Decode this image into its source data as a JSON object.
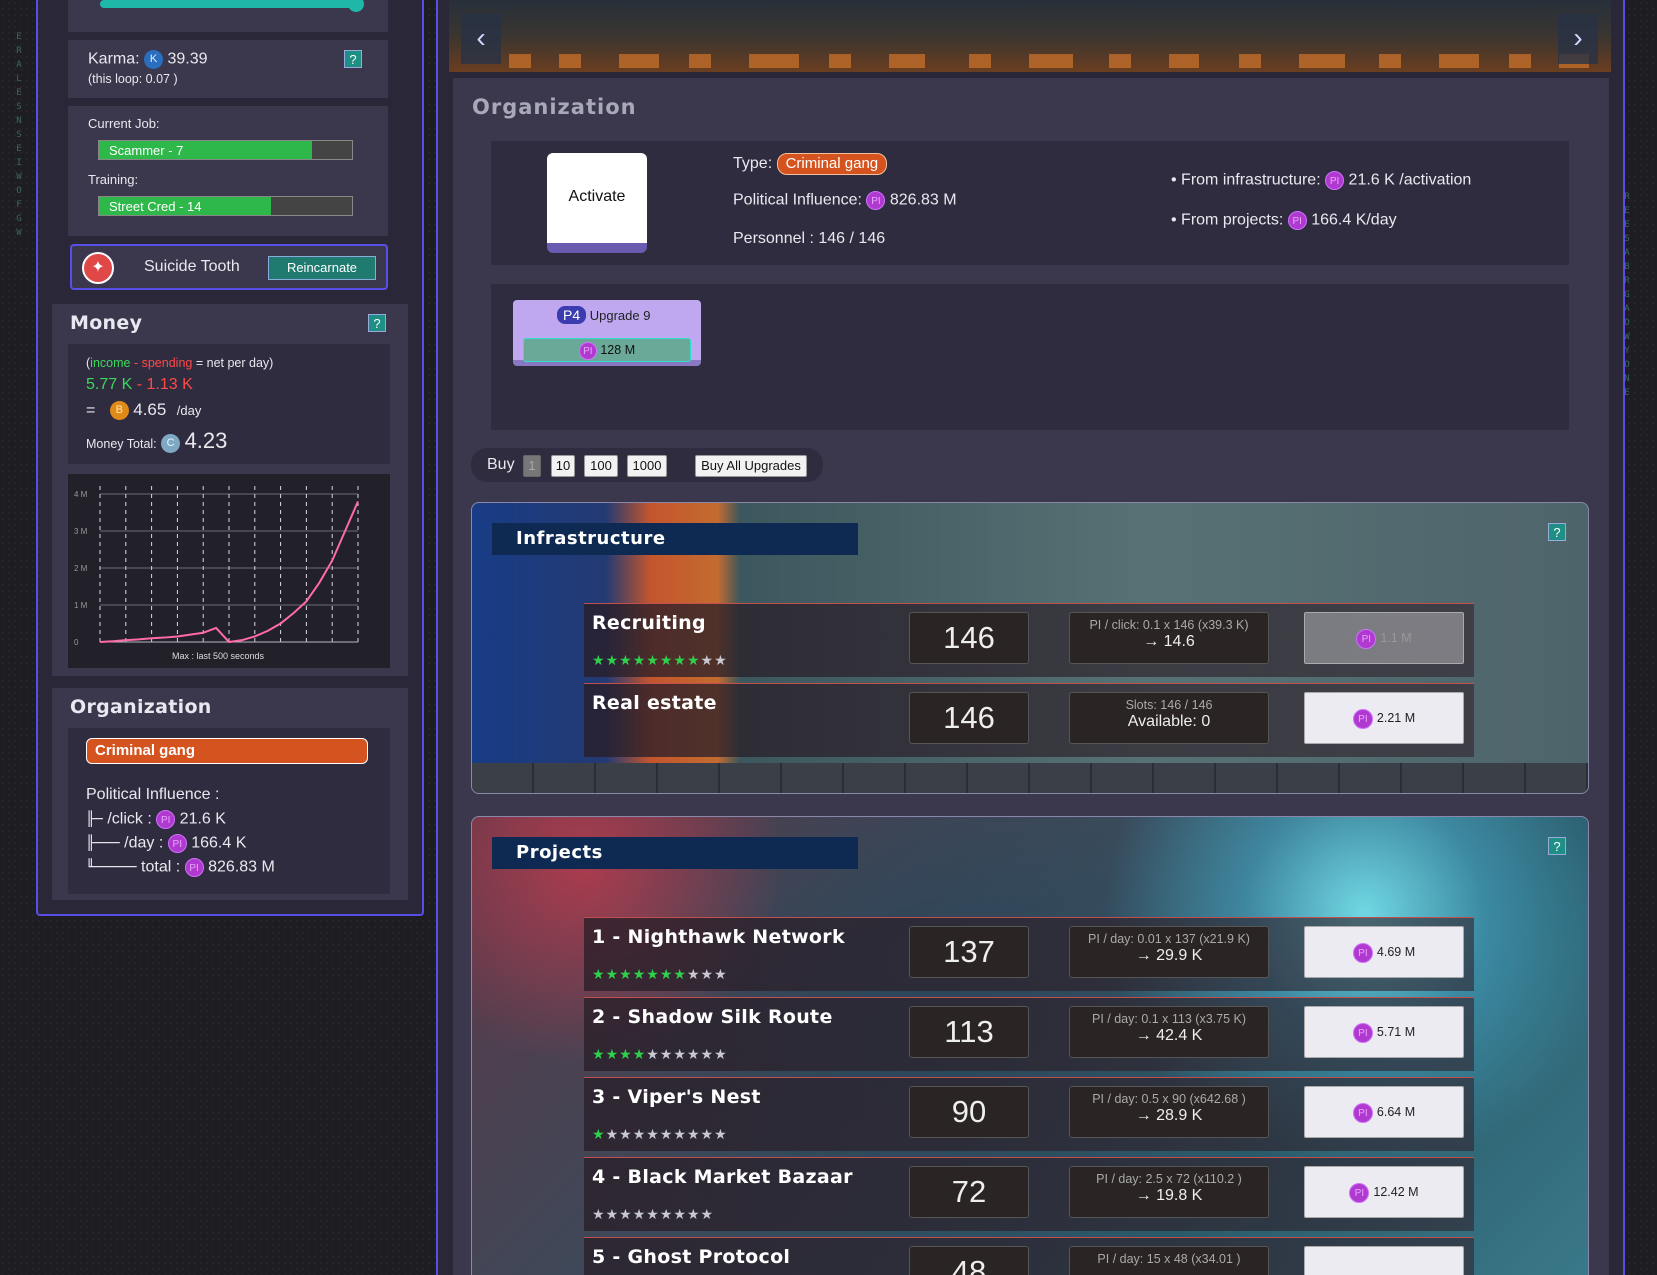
{
  "left": {
    "karma": {
      "label": "Karma:",
      "value": "39.39",
      "loop": "(this loop: 0.07 )",
      "help": "?"
    },
    "job": {
      "label": "Current Job:",
      "bar": "Scammer - 7",
      "progress": 0.84
    },
    "training": {
      "label": "Training:",
      "bar": "Street Cred - 14",
      "progress": 0.68
    },
    "reincarnate": {
      "name": "Suicide Tooth",
      "button": "Reincarnate"
    },
    "money": {
      "title": "Money",
      "help": "?",
      "formula_income": "income",
      "formula_dash": "-",
      "formula_spending": "spending",
      "formula_rest": "= net per day)",
      "formula_open": "(",
      "income": "5.77 K",
      "spending": "1.13 K",
      "net_eq": "=",
      "net": "4.65",
      "net_unit": "/day",
      "total_label": "Money Total:",
      "total": "4.23",
      "chart_note": "Max : last 500 seconds",
      "y_ticks": [
        "4 M",
        "3 M",
        "2 M",
        "1 M",
        "0"
      ]
    },
    "organization": {
      "title": "Organization",
      "type": "Criminal gang",
      "pi_label": "Political Influence :",
      "click_label": "/click :",
      "click": "21.6 K",
      "day_label": "/day :",
      "day": "166.4 K",
      "total_label": "total :",
      "total": "826.83 M"
    }
  },
  "chart_data": {
    "type": "line",
    "title": "",
    "note": "Max : last 500 seconds",
    "ylabel": "",
    "xlabel": "",
    "yticks": [
      "4 M",
      "3 M",
      "2 M",
      "1 M",
      "0"
    ],
    "ylim": [
      0,
      4
    ],
    "x": [
      0,
      25,
      50,
      75,
      100,
      125,
      150,
      175,
      200,
      225,
      250,
      275,
      300,
      325,
      350,
      375,
      400,
      425,
      450,
      475,
      500
    ],
    "y": [
      0.0,
      0.02,
      0.05,
      0.07,
      0.1,
      0.12,
      0.15,
      0.2,
      0.25,
      0.38,
      0.0,
      0.05,
      0.15,
      0.3,
      0.5,
      0.78,
      1.1,
      1.6,
      2.2,
      3.0,
      3.8
    ]
  },
  "banner": {
    "prev": "‹",
    "next": "›"
  },
  "org": {
    "title": "Organization",
    "activate": "Activate",
    "type_label": "Type:",
    "type": "Criminal gang",
    "pi_label": "Political Influence:",
    "pi": "826.83 M",
    "personnel": "Personnel : 146 / 146",
    "from_infra_label": "From infrastructure:",
    "from_infra": "21.6 K /activation",
    "from_proj_label": "From projects:",
    "from_proj": "166.4 K/day",
    "upgrade_badge": "P4",
    "upgrade_label": "Upgrade 9",
    "upgrade_cost": "128 M"
  },
  "buy": {
    "label": "Buy",
    "opt1": "1",
    "opt10": "10",
    "opt100": "100",
    "opt1000": "1000",
    "all": "Buy All Upgrades"
  },
  "infrastructure": {
    "title": "Infrastructure",
    "help": "?",
    "rows": [
      {
        "name": "Recruiting",
        "stars_on": 8,
        "stars_total": 10,
        "count": "146",
        "l1": "PI / click: 0.1 x 146 (x39.3 K)",
        "l2": "→ 14.6",
        "cost": "1.1 M",
        "disabled": true
      },
      {
        "name": "Real estate",
        "stars_on": 0,
        "stars_total": 0,
        "count": "146",
        "l1": "Slots: 146 / 146",
        "l2": "Available: 0",
        "cost": "2.21 M",
        "disabled": false
      }
    ]
  },
  "projects": {
    "title": "Projects",
    "help": "?",
    "rows": [
      {
        "name": "1 - Nighthawk Network",
        "stars_on": 7,
        "stars_total": 10,
        "count": "137",
        "l1": "PI / day: 0.01 x 137 (x21.9 K)",
        "l2": "→ 29.9 K",
        "cost": "4.69 M"
      },
      {
        "name": "2 - Shadow Silk Route",
        "stars_on": 4,
        "stars_total": 10,
        "count": "113",
        "l1": "PI / day: 0.1 x 113 (x3.75 K)",
        "l2": "→ 42.4 K",
        "cost": "5.71 M"
      },
      {
        "name": "3 - Viper's Nest",
        "stars_on": 1,
        "stars_total": 10,
        "count": "90",
        "l1": "PI / day: 0.5 x 90 (x642.68 )",
        "l2": "→ 28.9 K",
        "cost": "6.64 M"
      },
      {
        "name": "4 - Black Market Bazaar",
        "stars_on": 0,
        "stars_total": 9,
        "count": "72",
        "l1": "PI / day: 2.5 x 72 (x110.2 )",
        "l2": "→ 19.8 K",
        "cost": "12.42 M"
      },
      {
        "name": "5 - Ghost Protocol",
        "stars_on": 0,
        "stars_total": 0,
        "count": "48",
        "l1": "PI / day: 15 x 48 (x34.01 )",
        "l2": "",
        "cost": ""
      }
    ]
  },
  "colors": {
    "accent": "#5a4ee8",
    "green": "#2fd04a",
    "orange": "#d5531e",
    "income": "#3ad85a",
    "spending": "#ff4a4a"
  }
}
